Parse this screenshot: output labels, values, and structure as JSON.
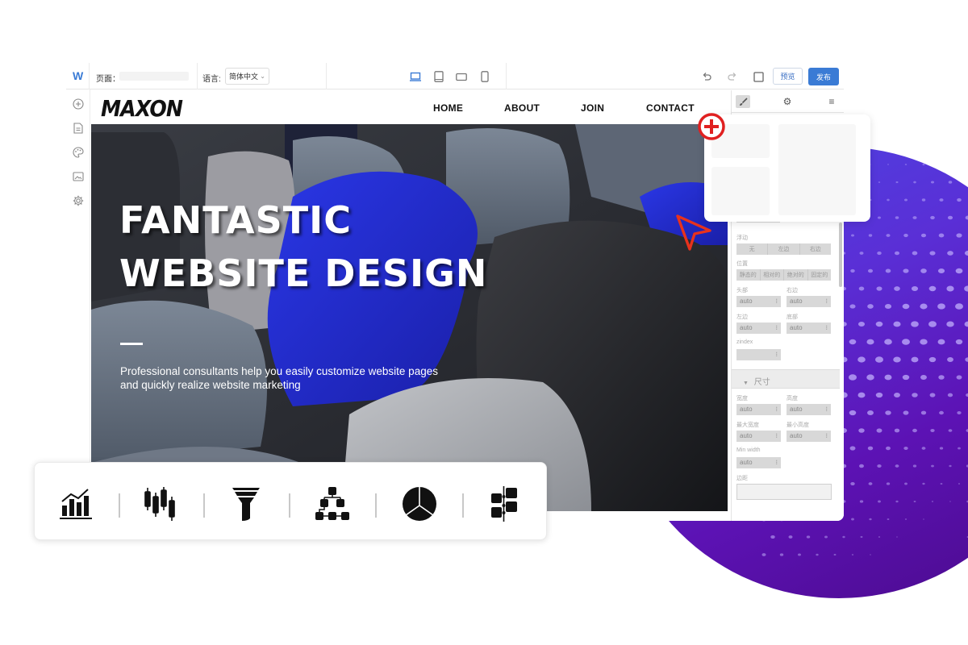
{
  "topbar": {
    "logo": "W",
    "page_label": "页面：",
    "page_value": "",
    "language_label": "语言:",
    "language_value": "简体中文",
    "devices": [
      "desktop-icon",
      "tablet-icon",
      "tablet-landscape-icon",
      "mobile-icon"
    ],
    "active_device": "desktop-icon",
    "undo": "undo-icon",
    "redo": "redo-icon",
    "fullscreen": "square-icon",
    "preview_label": "预览",
    "publish_label": "发布",
    "accent_color": "#3a7bd5"
  },
  "leftbar": {
    "items": [
      {
        "icon": "add-circle-icon",
        "label": "Add"
      },
      {
        "icon": "page-icon",
        "label": "Pages"
      },
      {
        "icon": "palette-icon",
        "label": "Theme"
      },
      {
        "icon": "image-icon",
        "label": "Media"
      },
      {
        "icon": "gear-icon",
        "label": "Settings"
      }
    ]
  },
  "site": {
    "logo": "MAXON",
    "nav": [
      "HOME",
      "ABOUT",
      "JOIN",
      "CONTACT"
    ],
    "hero_title_1": "FANTASTIC",
    "hero_title_2": "WEBSITE DESIGN",
    "hero_subtitle": "Professional consultants help you easily customize website pages and quickly realize website marketing"
  },
  "panel": {
    "tabs": [
      "brush-icon",
      "gear-icon",
      "menu-icon"
    ],
    "active_tab": "brush-icon",
    "float_label": "浮动",
    "float_options": [
      "无",
      "左边",
      "右边"
    ],
    "position_label": "位置",
    "position_options": [
      "静态的",
      "相对的",
      "绝对的",
      "固定的"
    ],
    "top_label": "头部",
    "right_label": "右边",
    "left_label": "左边",
    "bottom_label": "底部",
    "top_value": "auto",
    "right_value": "auto",
    "left_value": "auto",
    "bottom_value": "auto",
    "zindex_label": "zindex",
    "zindex_value": "",
    "size_section": "尺寸",
    "width_label": "宽度",
    "height_label": "高度",
    "width_value": "auto",
    "height_value": "auto",
    "max_width_label": "最大宽度",
    "min_height_label": "最小高度",
    "max_width_value": "auto",
    "min_height_value": "auto",
    "min_width_label": "Min width",
    "min_width_value": "auto",
    "margin_label": "边距"
  },
  "chart_toolbar": {
    "icons": [
      "bar-line-chart-icon",
      "candlestick-chart-icon",
      "funnel-chart-icon",
      "tree-chart-icon",
      "pie-chart-icon",
      "timeline-chart-icon"
    ]
  },
  "colors": {
    "accent": "#3a7bd5",
    "circle_start": "#4a47e4",
    "circle_end": "#4a0a8a",
    "highlight_red": "#e02020"
  }
}
